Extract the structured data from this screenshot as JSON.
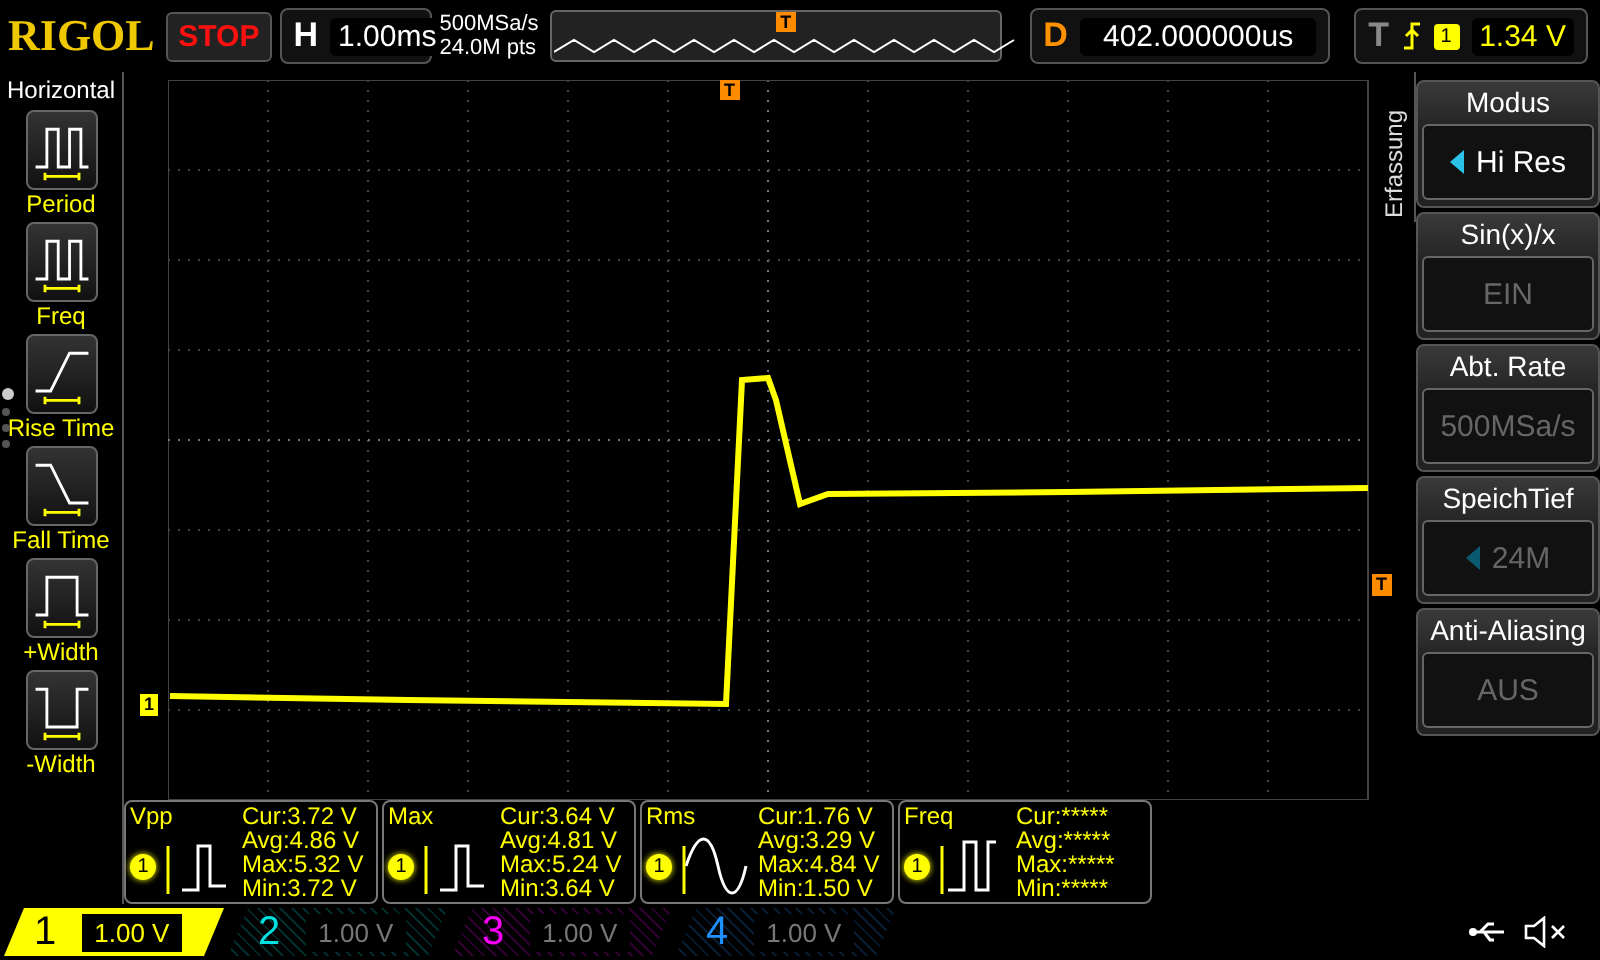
{
  "header": {
    "brand": "RIGOL",
    "run_state": "STOP",
    "timebase": {
      "label": "H",
      "value": "1.00ms"
    },
    "sample_rate": "500MSa/s",
    "memory_depth": "24.0M pts",
    "delay": {
      "label": "D",
      "value": "402.000000us"
    },
    "trigger": {
      "label": "T",
      "source": "1",
      "level": "1.34 V"
    },
    "overview_trigger_marker": "T"
  },
  "left_panel": {
    "title": "Horizontal",
    "items": [
      {
        "label": "Period",
        "kind": "period"
      },
      {
        "label": "Freq",
        "kind": "freq"
      },
      {
        "label": "Rise Time",
        "kind": "rise"
      },
      {
        "label": "Fall Time",
        "kind": "fall"
      },
      {
        "label": "+Width",
        "kind": "pwidth"
      },
      {
        "label": "-Width",
        "kind": "nwidth"
      }
    ],
    "pages": [
      {
        "selected": true
      },
      {
        "selected": false
      },
      {
        "selected": false
      },
      {
        "selected": false
      }
    ]
  },
  "screen": {
    "trigger_marker": "T",
    "trigger_level_marker": "T",
    "channel_marker": "1"
  },
  "right_menu": {
    "tab": "Erfassung",
    "items": [
      {
        "title": "Modus",
        "value": "Hi Res",
        "disabled": false,
        "arrow": true
      },
      {
        "title": "Sin(x)/x",
        "value": "EIN",
        "disabled": true,
        "arrow": false
      },
      {
        "title": "Abt. Rate",
        "value": "500MSa/s",
        "disabled": true,
        "arrow": false
      },
      {
        "title": "SpeichTief",
        "value": "24M",
        "disabled": true,
        "arrow": true
      },
      {
        "title": "Anti-Aliasing",
        "value": "AUS",
        "disabled": true,
        "arrow": false
      }
    ]
  },
  "measurements": [
    {
      "name": "Vpp",
      "channel": "1",
      "kind": "pulse",
      "cur": "Cur:3.72 V",
      "avg": "Avg:4.86 V",
      "max": "Max:5.32 V",
      "min": "Min:3.72 V"
    },
    {
      "name": "Max",
      "channel": "1",
      "kind": "pulse",
      "cur": "Cur:3.64 V",
      "avg": "Avg:4.81 V",
      "max": "Max:5.24 V",
      "min": "Min:3.64 V"
    },
    {
      "name": "Rms",
      "channel": "1",
      "kind": "sine",
      "cur": "Cur:1.76 V",
      "avg": "Avg:3.29 V",
      "max": "Max:4.84 V",
      "min": "Min:1.50 V"
    },
    {
      "name": "Freq",
      "channel": "1",
      "kind": "freq",
      "cur": "Cur:*****",
      "avg": "Avg:*****",
      "max": "Max:*****",
      "min": "Min:*****"
    }
  ],
  "channels": [
    {
      "number": "1",
      "scale": "1.00 V",
      "on": true,
      "color": "#ffff00"
    },
    {
      "number": "2",
      "scale": "1.00 V",
      "on": false,
      "color": "#00e0e0"
    },
    {
      "number": "3",
      "scale": "1.00 V",
      "on": false,
      "color": "#ff00ff"
    },
    {
      "number": "4",
      "scale": "1.00 V",
      "on": false,
      "color": "#1e90ff"
    }
  ],
  "status": {
    "usb_connected": true,
    "sound_muted": true
  }
}
